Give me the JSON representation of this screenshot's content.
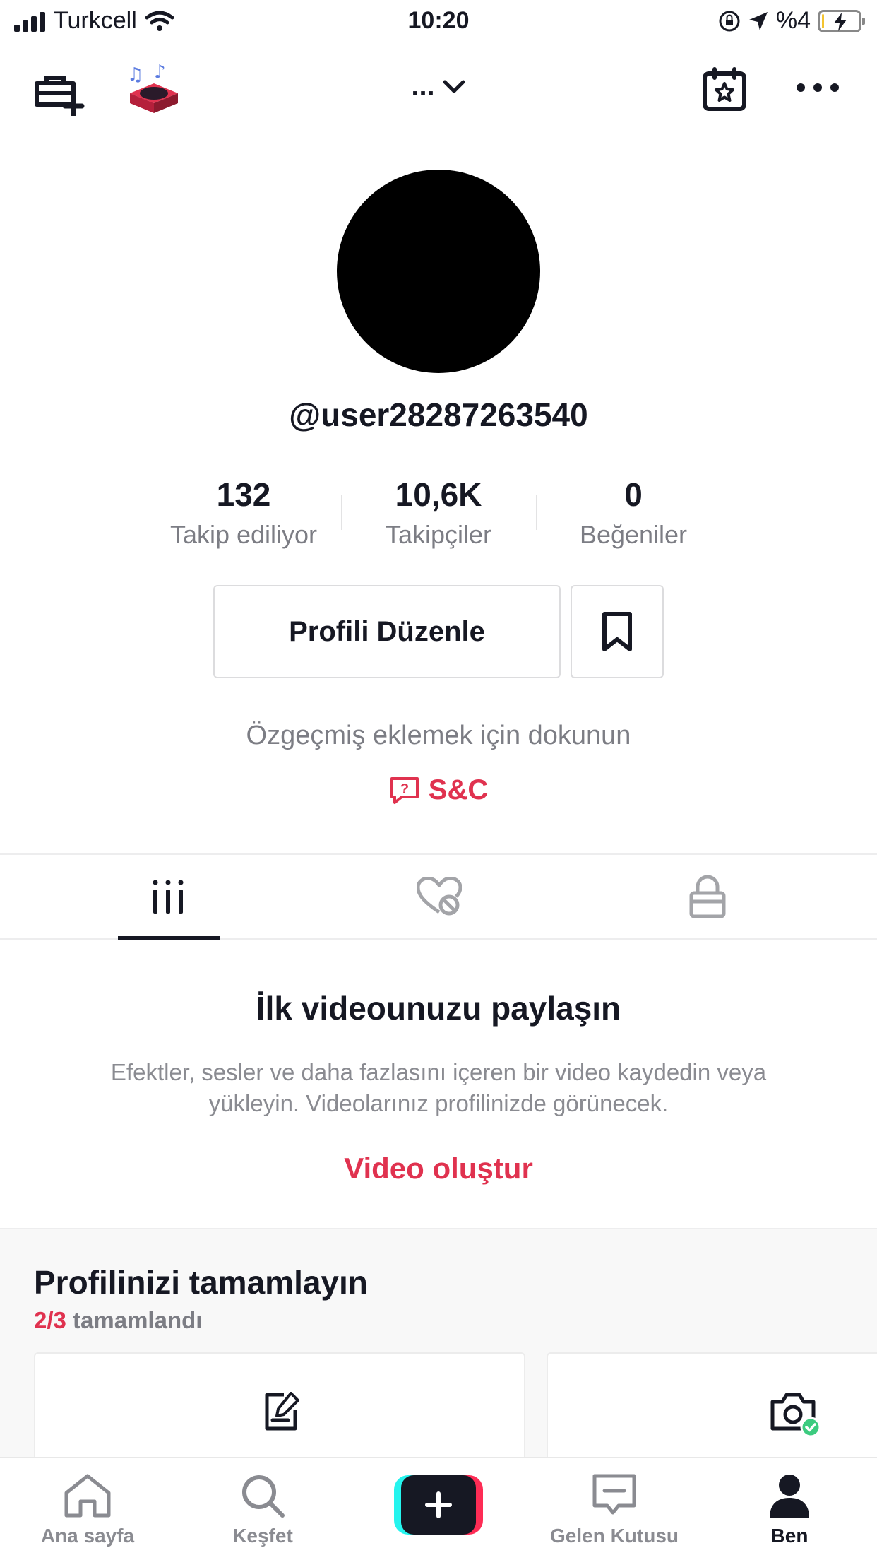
{
  "status_bar": {
    "carrier": "Turkcell",
    "time": "10:20",
    "battery_percent": "%4",
    "battery_level": 0.04
  },
  "top_nav": {
    "title": "...",
    "icons": [
      "add-account-icon",
      "music-disc-icon",
      "chevron-down-icon",
      "calendar-star-icon",
      "more-icon"
    ]
  },
  "profile": {
    "username": "@user28287263540",
    "stats": [
      {
        "value": "132",
        "label": "Takip ediliyor"
      },
      {
        "value": "10,6K",
        "label": "Takipçiler"
      },
      {
        "value": "0",
        "label": "Beğeniler"
      }
    ],
    "edit_button": "Profili Düzenle",
    "bio_placeholder": "Özgeçmiş eklemek için dokunun",
    "qa_label": "S&C"
  },
  "tabs": [
    "videos-grid-icon",
    "liked-hidden-icon",
    "private-lock-icon"
  ],
  "empty_state": {
    "title": "İlk videounuzu paylaşın",
    "description": "Efektler, sesler ve daha fazlasını içeren bir video kaydedin veya yükleyin. Videolarınız profilinizde görünecek.",
    "cta": "Video oluştur"
  },
  "complete_profile": {
    "title": "Profilinizi tamamlayın",
    "progress_done": "2/3",
    "progress_suffix": "tamamlandı"
  },
  "bottom_nav": {
    "items": [
      {
        "label": "Ana sayfa",
        "icon": "home-icon"
      },
      {
        "label": "Keşfet",
        "icon": "search-icon"
      },
      {
        "label": "",
        "icon": "plus-icon"
      },
      {
        "label": "Gelen Kutusu",
        "icon": "inbox-icon"
      },
      {
        "label": "Ben",
        "icon": "profile-icon"
      }
    ]
  },
  "colors": {
    "accent": "#e0324f",
    "text_primary": "#161823",
    "text_secondary": "#7c7d84"
  }
}
